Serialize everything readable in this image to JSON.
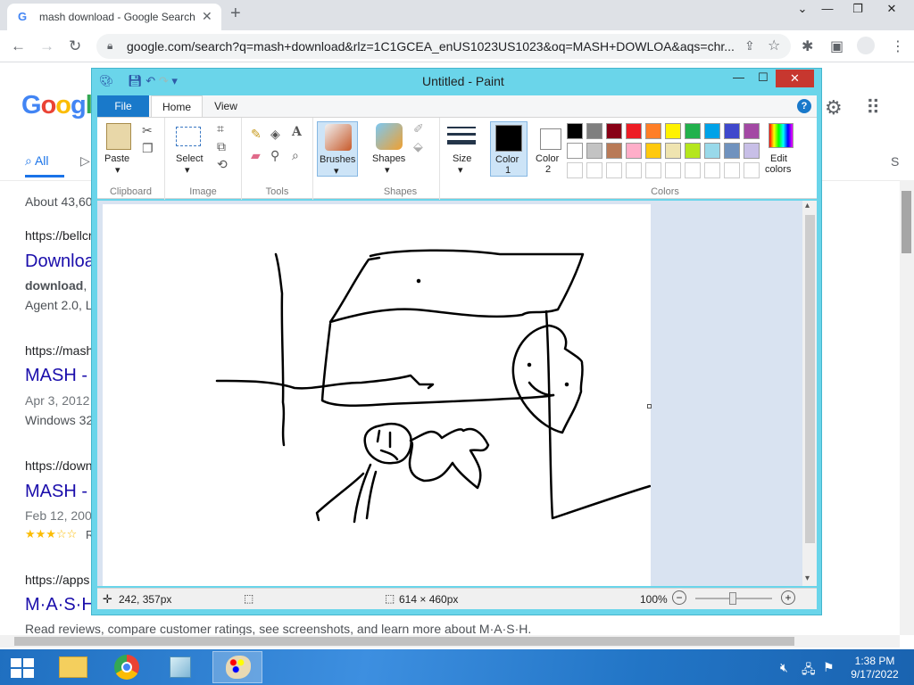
{
  "browser": {
    "tab_title": "mash download - Google Search",
    "url": "google.com/search?q=mash+download&rlz=1C1GCEA_enUS1023US1023&oq=MASH+DOWLOA&aqs=chr..."
  },
  "google": {
    "logo": "Google",
    "tabs": {
      "all": "All"
    },
    "partial_s": "S",
    "about": "About 43,60",
    "results": [
      {
        "url": "https://bellcr",
        "title": "Downloa",
        "snippet_bold": "download",
        "snippet_rest": ",",
        "snippet2": "Agent 2.0, L"
      },
      {
        "url": "https://mash",
        "title": "MASH -",
        "date": "Apr 3, 2012",
        "snippet": "Windows 32"
      },
      {
        "url": "https://down",
        "title": "MASH -",
        "date": "Feb 12, 200",
        "rating_stars": "★★★☆☆",
        "rating_tail": "R"
      },
      {
        "url": "https://apps",
        "title": "M·A·S·H"
      }
    ],
    "reviews_line": "Read reviews, compare customer ratings, see screenshots, and learn more about M·A·S·H."
  },
  "paint": {
    "title": "Untitled - Paint",
    "tabs": {
      "file": "File",
      "home": "Home",
      "view": "View"
    },
    "help": "?",
    "groups": {
      "clipboard": "Clipboard",
      "image": "Image",
      "tools": "Tools",
      "shapes": "Shapes",
      "colors": "Colors"
    },
    "buttons": {
      "paste": "Paste",
      "select": "Select",
      "brushes": "Brushes",
      "shapes": "Shapes",
      "size": "Size",
      "color1": "Color\n1",
      "color1_a": "Color",
      "color1_b": "1",
      "color2_a": "Color",
      "color2_b": "2",
      "edit_colors_a": "Edit",
      "edit_colors_b": "colors"
    },
    "palette_row1": [
      "#000000",
      "#7f7f7f",
      "#880015",
      "#ed1c24",
      "#ff7f27",
      "#fff200",
      "#22b14c",
      "#00a2e8",
      "#3f48cc",
      "#a349a4"
    ],
    "palette_row2": [
      "#ffffff",
      "#c3c3c3",
      "#b97a57",
      "#ffaec9",
      "#ffc90e",
      "#efe4b0",
      "#b5e61d",
      "#99d9ea",
      "#7092be",
      "#c8bfe7"
    ],
    "status": {
      "cursor": "242, 357px",
      "canvas_size": "614 × 460px",
      "zoom": "100%"
    }
  },
  "taskbar": {
    "time": "1:38 PM",
    "date": "9/17/2022"
  }
}
